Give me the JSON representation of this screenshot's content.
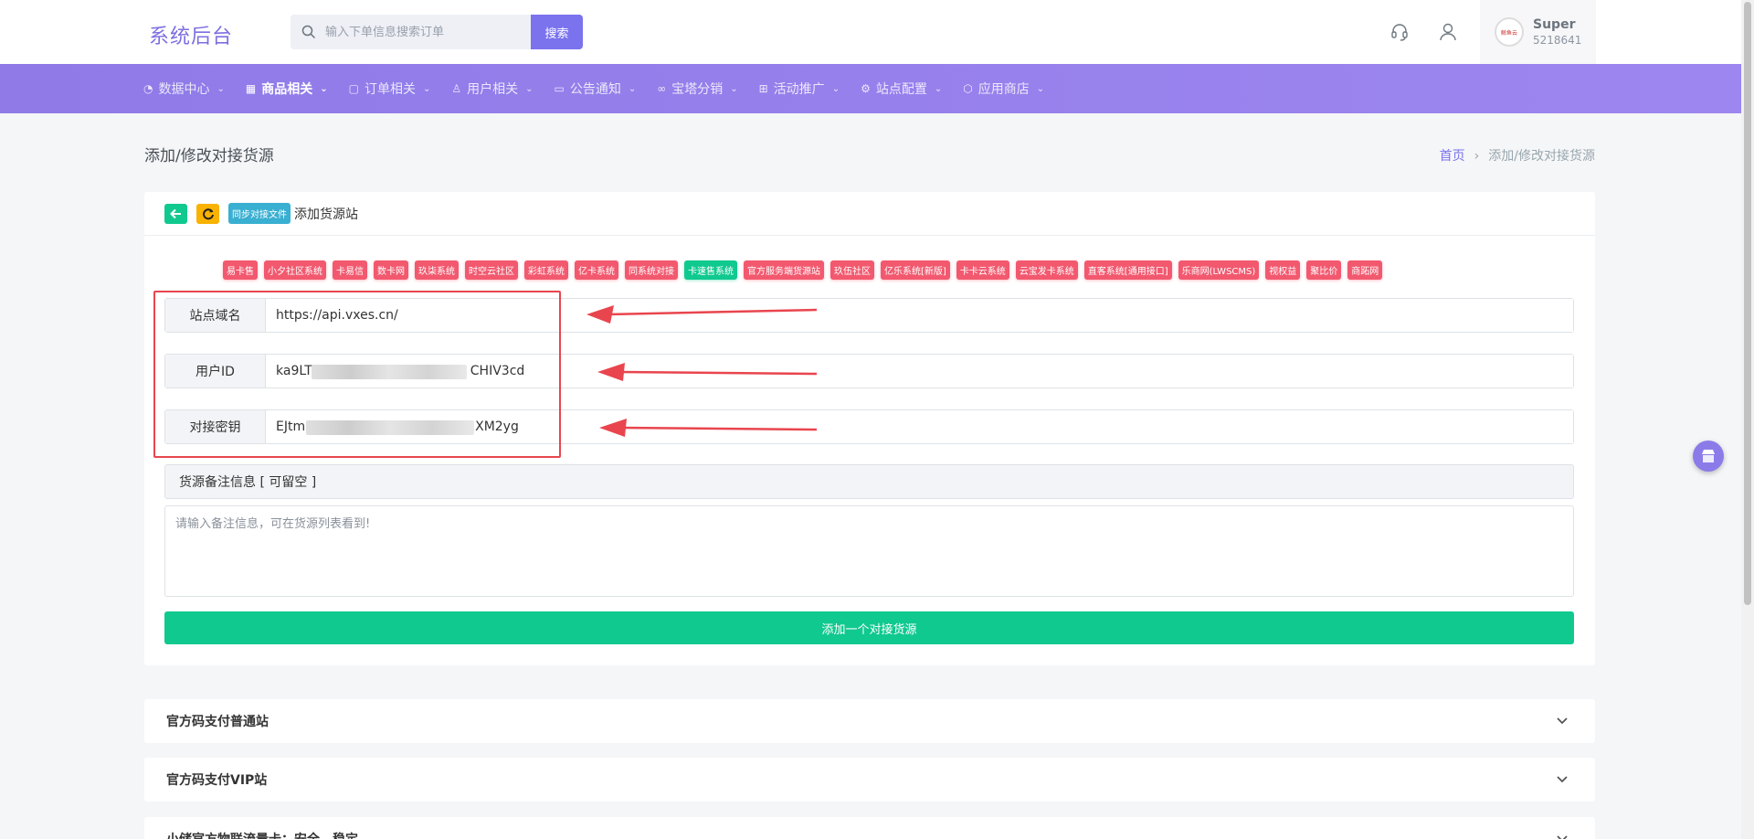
{
  "header": {
    "logo_text": "系统后台",
    "search_placeholder": "输入下单信息搜索订单",
    "search_button": "搜索",
    "user": {
      "name": "Super",
      "id": "5218641",
      "avatar_text": "鲸鱼云"
    }
  },
  "nav": {
    "items": [
      {
        "label": "数据中心",
        "icon": "gauge-icon",
        "active": false
      },
      {
        "label": "商品相关",
        "icon": "grid-icon",
        "active": true
      },
      {
        "label": "订单相关",
        "icon": "square-icon",
        "active": false
      },
      {
        "label": "用户相关",
        "icon": "user-icon",
        "active": false
      },
      {
        "label": "公告通知",
        "icon": "book-icon",
        "active": false
      },
      {
        "label": "宝塔分销",
        "icon": "link-icon",
        "active": false
      },
      {
        "label": "活动推广",
        "icon": "gift-icon",
        "active": false
      },
      {
        "label": "站点配置",
        "icon": "gear-icon",
        "active": false
      },
      {
        "label": "应用商店",
        "icon": "box-icon",
        "active": false
      }
    ]
  },
  "page": {
    "title": "添加/修改对接货源",
    "breadcrumb_home": "首页",
    "breadcrumb_sep": "›",
    "breadcrumb_current": "添加/修改对接货源"
  },
  "card": {
    "sync_badge": "同步对接文件",
    "title": "添加货源站",
    "tags": [
      {
        "label": "易卡售",
        "active": false
      },
      {
        "label": "小夕社区系统",
        "active": false
      },
      {
        "label": "卡易信",
        "active": false
      },
      {
        "label": "数卡网",
        "active": false
      },
      {
        "label": "玖柒系统",
        "active": false
      },
      {
        "label": "时空云社区",
        "active": false
      },
      {
        "label": "彩虹系统",
        "active": false
      },
      {
        "label": "亿卡系统",
        "active": false
      },
      {
        "label": "同系统对接",
        "active": false
      },
      {
        "label": "卡速售系统",
        "active": true
      },
      {
        "label": "官方服务端货源站",
        "active": false
      },
      {
        "label": "玖伍社区",
        "active": false
      },
      {
        "label": "亿乐系统[新版]",
        "active": false
      },
      {
        "label": "卡卡云系统",
        "active": false
      },
      {
        "label": "云宝发卡系统",
        "active": false
      },
      {
        "label": "直客系统[通用接口]",
        "active": false
      },
      {
        "label": "乐商网(LWSCMS)",
        "active": false
      },
      {
        "label": "视权益",
        "active": false
      },
      {
        "label": "聚比价",
        "active": false
      },
      {
        "label": "商跖网",
        "active": false
      }
    ],
    "fields": {
      "domain": {
        "label": "站点域名",
        "value": "https://api.vxes.cn/"
      },
      "user_id": {
        "label": "用户ID",
        "value_start": "ka9LT",
        "value_end": "CHIV3cd"
      },
      "secret": {
        "label": "对接密钥",
        "value_start": "EJtm",
        "value_end": "XM2yg"
      }
    },
    "note_label": "货源备注信息 [ 可留空 ]",
    "note_placeholder": "请输入备注信息，可在货源列表看到!",
    "submit_label": "添加一个对接货源"
  },
  "accordion": [
    {
      "label": "官方码支付普通站"
    },
    {
      "label": "官方码支付VIP站"
    },
    {
      "label": "小储官方物联流量卡：安全、稳定"
    }
  ],
  "colors": {
    "primary": "#7b72ee",
    "success": "#10c98f",
    "danger": "#f2596f",
    "annotation_red": "#e9454e"
  }
}
